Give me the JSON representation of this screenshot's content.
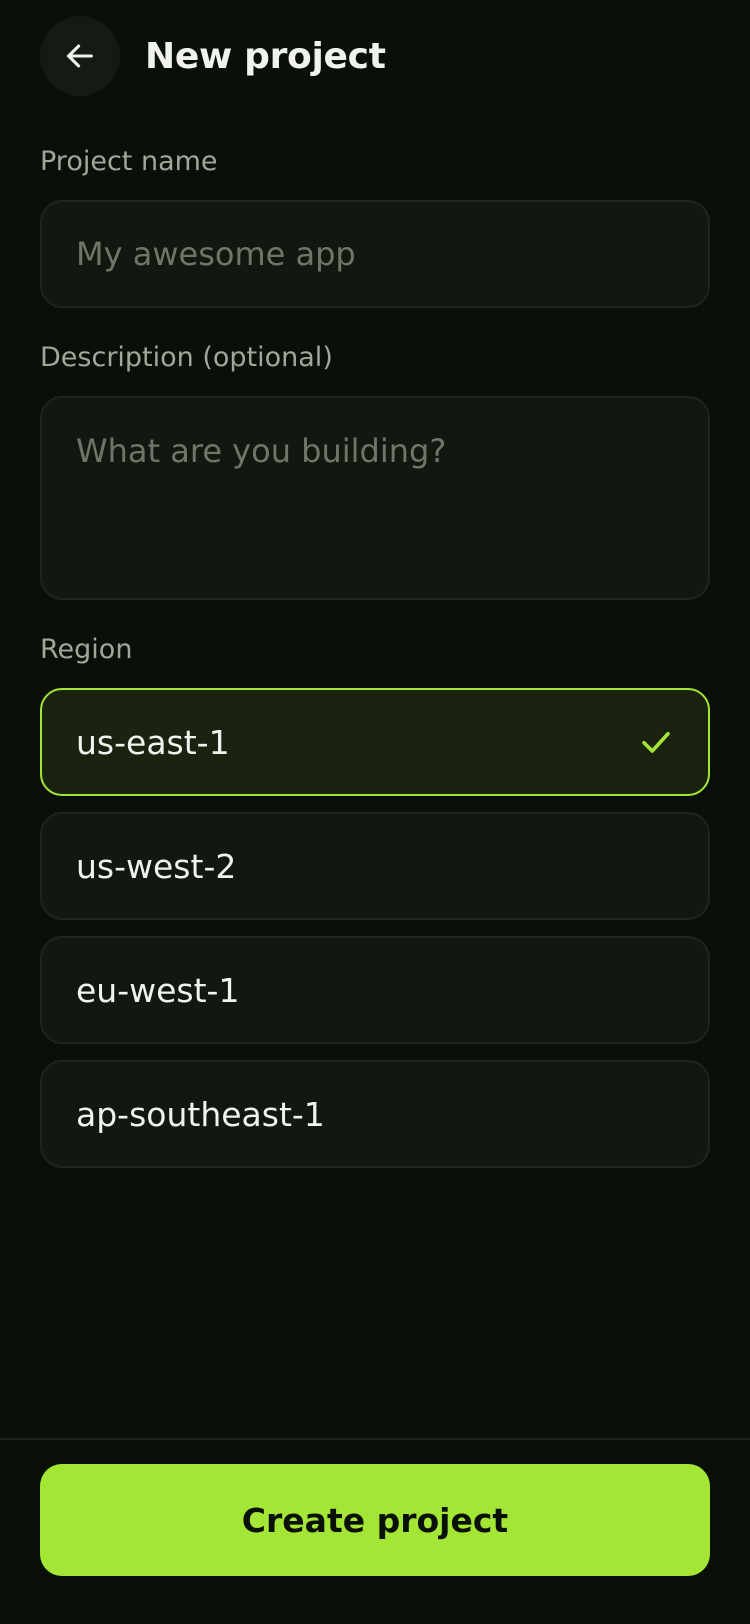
{
  "header": {
    "title": "New project",
    "back_icon": "arrow-left-icon"
  },
  "form": {
    "project_name": {
      "label": "Project name",
      "value": "",
      "placeholder": "My awesome app"
    },
    "description": {
      "label": "Description (optional)",
      "value": "",
      "placeholder": "What are you building?"
    },
    "region": {
      "label": "Region",
      "selected": "us-east-1",
      "options": [
        {
          "label": "us-east-1",
          "selected": true
        },
        {
          "label": "us-west-2",
          "selected": false
        },
        {
          "label": "eu-west-1",
          "selected": false
        },
        {
          "label": "ap-southeast-1",
          "selected": false
        }
      ]
    }
  },
  "footer": {
    "create_label": "Create project"
  },
  "colors": {
    "background": "#0a0f08",
    "accent": "#a4e635",
    "surface": "#12180f"
  }
}
